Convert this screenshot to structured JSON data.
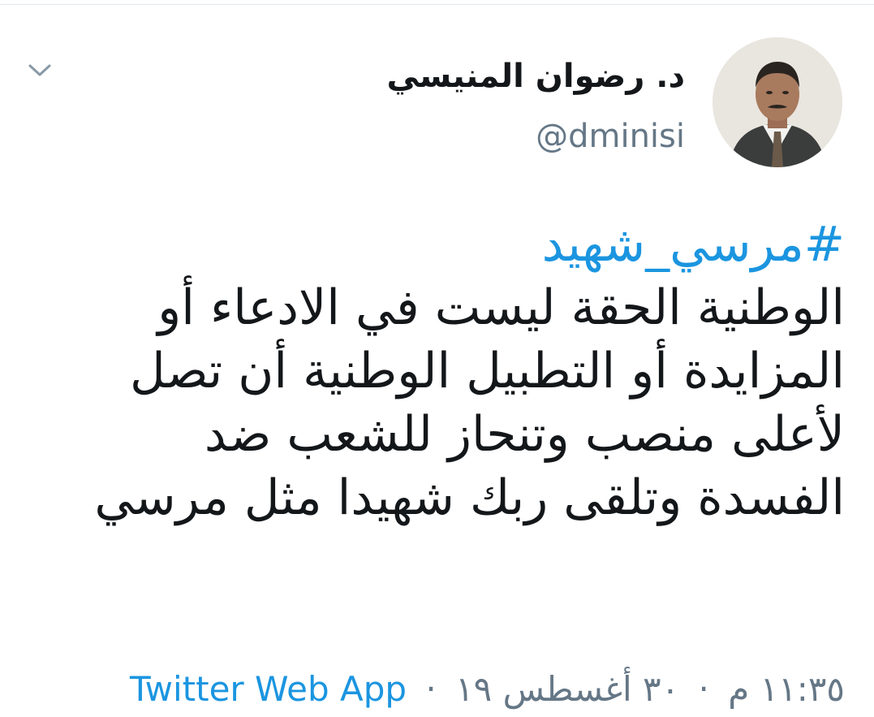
{
  "tweet": {
    "display_name": "د. رضوان المنيسي",
    "handle": "@dminisi",
    "hashtag": "#مرسي_شهيد",
    "body_lines": [
      "الوطنية الحقة ليست في الادعاء أو",
      "المزايدة أو التطبيل الوطنية أن تصل",
      "لأعلى منصب وتنحاز للشعب ضد",
      "الفسدة وتلقى ربك شهيدا مثل مرسي"
    ],
    "time": "١١:٣٥ م",
    "date": "٣٠ أغسطس ١٩",
    "separator": "·",
    "source": "Twitter Web App"
  },
  "icons": {
    "menu": "chevron-down-icon",
    "avatar": "avatar-photo"
  },
  "colors": {
    "link": "#1b95e0",
    "secondary_text": "#657786",
    "primary_text": "#14171a",
    "divider": "#e1e8ed"
  }
}
